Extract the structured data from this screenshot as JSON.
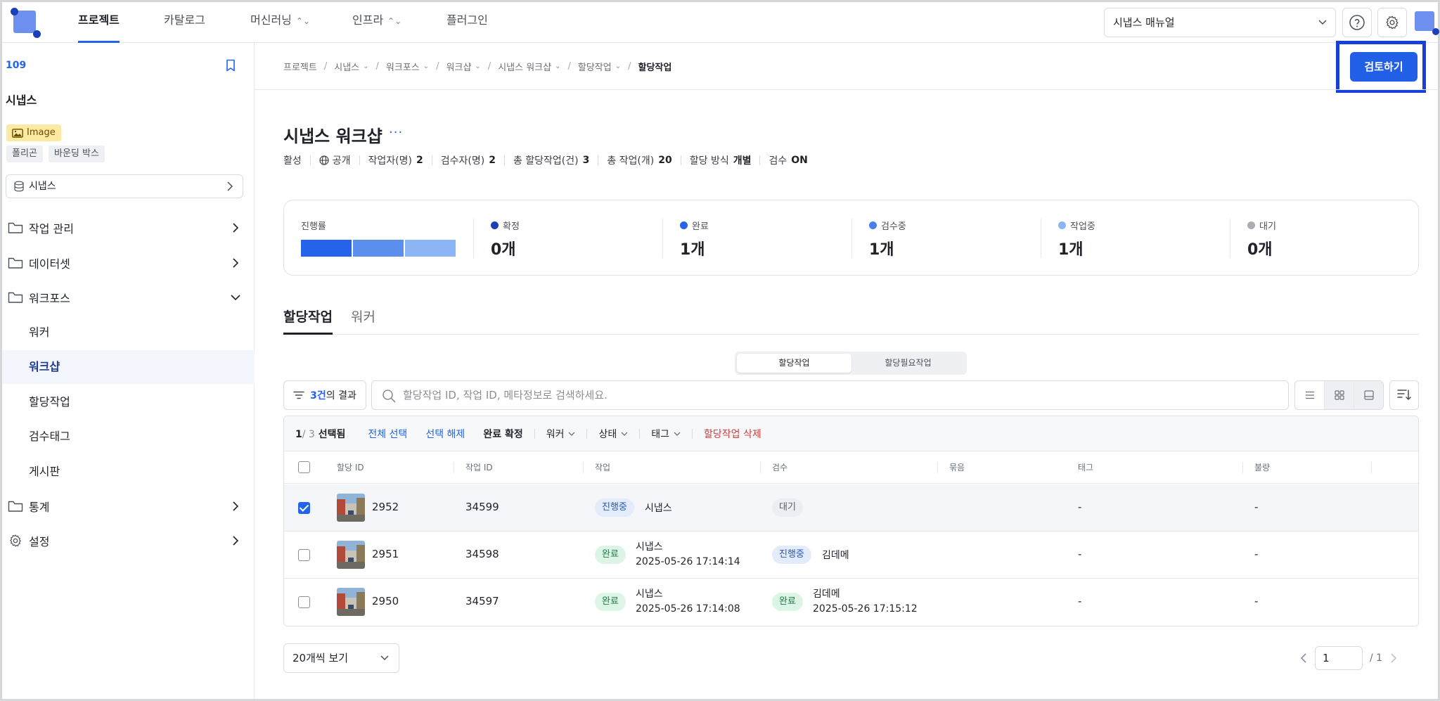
{
  "nav": {
    "tabs": [
      {
        "label": "프로젝트"
      },
      {
        "label": "카탈로그"
      },
      {
        "label": "머신러닝"
      },
      {
        "label": "인프라"
      },
      {
        "label": "플러그인"
      }
    ],
    "manual_select": "시냅스 매뉴얼"
  },
  "sidebar": {
    "project_id": "109",
    "project_name": "시냅스",
    "type_badge": "Image",
    "tags": [
      "폴리곤",
      "바운딩 박스"
    ],
    "dataset": "시냅스",
    "menu": {
      "job_manage": "작업 관리",
      "dataset": "데이터셋",
      "workforce": "워크포스",
      "worker": "워커",
      "workshop": "워크샵",
      "assignment": "할당작업",
      "review_tag": "검수태그",
      "board": "게시판",
      "stats": "통계",
      "settings": "설정"
    }
  },
  "breadcrumb": [
    "프로젝트",
    "시냅스",
    "워크포스",
    "워크샵",
    "시냅스 워크샵",
    "할당작업",
    "할당작업"
  ],
  "review_button": "검토하기",
  "header": {
    "title": "시냅스 워크샵",
    "more": "···",
    "meta": {
      "status": "활성",
      "visibility": "공개",
      "workers_label": "작업자(명)",
      "workers": "2",
      "reviewers_label": "검수자(명)",
      "reviewers": "2",
      "total_assign_label": "총 할당작업(건)",
      "total_assign": "3",
      "total_jobs_label": "총 작업(개)",
      "total_jobs": "20",
      "assign_method_label": "할당 방식",
      "assign_method": "개별",
      "review_label": "검수",
      "review": "ON"
    }
  },
  "stats": {
    "progress_label": "진행률",
    "progress_segments": [
      {
        "fraction": 0.333,
        "color": "#2563eb"
      },
      {
        "fraction": 0.333,
        "color": "#5b8fee"
      },
      {
        "fraction": 0.333,
        "color": "#8cb5f5"
      }
    ],
    "items": [
      {
        "label": "확정",
        "value": "0개",
        "color": "#1d3fb8"
      },
      {
        "label": "완료",
        "value": "1개",
        "color": "#2563eb"
      },
      {
        "label": "검수중",
        "value": "1개",
        "color": "#4a7fe8"
      },
      {
        "label": "작업중",
        "value": "1개",
        "color": "#8cb5f5"
      },
      {
        "label": "대기",
        "value": "0개",
        "color": "#a9adb4"
      }
    ]
  },
  "tabs": {
    "assign": "할당작업",
    "worker": "워커"
  },
  "segment": {
    "assign": "할당작업",
    "need_assign": "할당필요작업"
  },
  "filter": {
    "count": "3건",
    "suffix": "의 결과"
  },
  "search": {
    "placeholder": "할당작업 ID, 작업 ID, 메타정보로 검색하세요."
  },
  "actionbar": {
    "selected": "1",
    "total": "/ 3",
    "selected_suffix": "선택됨",
    "select_all": "전체 선택",
    "deselect": "선택 해제",
    "confirm_done": "완료 확정",
    "worker": "워커",
    "status": "상태",
    "tag": "태그",
    "delete": "할당작업 삭제"
  },
  "columns": [
    "할당 ID",
    "작업 ID",
    "작업",
    "검수",
    "묶음",
    "태그",
    "불량"
  ],
  "rows": [
    {
      "assign_id": "2952",
      "job_id": "34599",
      "job_status": "진행중",
      "job_status_kind": "prog",
      "job_name": "시냅스",
      "job_time": "",
      "review_status": "대기",
      "review_status_kind": "wait",
      "reviewer": "",
      "review_time": "",
      "tag": "-",
      "defect": "-",
      "checked": true
    },
    {
      "assign_id": "2951",
      "job_id": "34598",
      "job_status": "완료",
      "job_status_kind": "done",
      "job_name": "시냅스",
      "job_time": "2025-05-26 17:14:14",
      "review_status": "진행중",
      "review_status_kind": "prog",
      "reviewer": "김데메",
      "review_time": "",
      "tag": "-",
      "defect": "-",
      "checked": false
    },
    {
      "assign_id": "2950",
      "job_id": "34597",
      "job_status": "완료",
      "job_status_kind": "done",
      "job_name": "시냅스",
      "job_time": "2025-05-26 17:14:08",
      "review_status": "완료",
      "review_status_kind": "done",
      "reviewer": "김데메",
      "review_time": "2025-05-26 17:15:12",
      "tag": "-",
      "defect": "-",
      "checked": false
    }
  ],
  "footer": {
    "per_page": "20개씩 보기",
    "page": "1",
    "total_pages": "/ 1"
  }
}
